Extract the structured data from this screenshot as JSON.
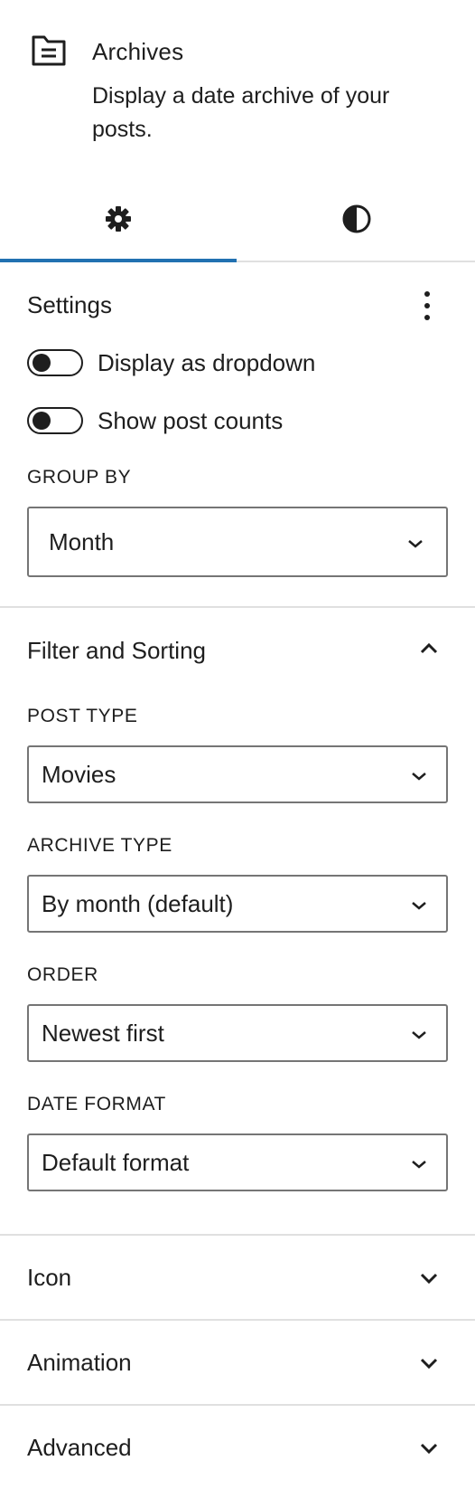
{
  "block": {
    "icon": "archive-document-icon",
    "title": "Archives",
    "description": "Display a date archive of your posts."
  },
  "tabs": [
    {
      "icon": "gear-icon",
      "label": "Settings",
      "active": true
    },
    {
      "icon": "contrast-half-circle-icon",
      "label": "Styles",
      "active": false
    }
  ],
  "settings": {
    "title": "Settings",
    "options_icon": "more-vertical-icon",
    "toggles": [
      {
        "label": "Display as dropdown",
        "checked": false
      },
      {
        "label": "Show post counts",
        "checked": false
      }
    ],
    "group_by": {
      "label": "GROUP BY",
      "value": "Month"
    }
  },
  "filter": {
    "title": "Filter and Sorting",
    "expanded": true,
    "fields": [
      {
        "label": "POST TYPE",
        "value": "Movies"
      },
      {
        "label": "ARCHIVE TYPE",
        "value": "By month (default)"
      },
      {
        "label": "ORDER",
        "value": "Newest first"
      },
      {
        "label": "DATE FORMAT",
        "value": "Default format"
      }
    ]
  },
  "collapsed_panels": [
    {
      "title": "Icon"
    },
    {
      "title": "Animation"
    },
    {
      "title": "Advanced"
    }
  ],
  "colors": {
    "accent": "#2271b1",
    "text": "#1e1e1e",
    "border": "#757575",
    "divider": "#e0e0e0"
  }
}
